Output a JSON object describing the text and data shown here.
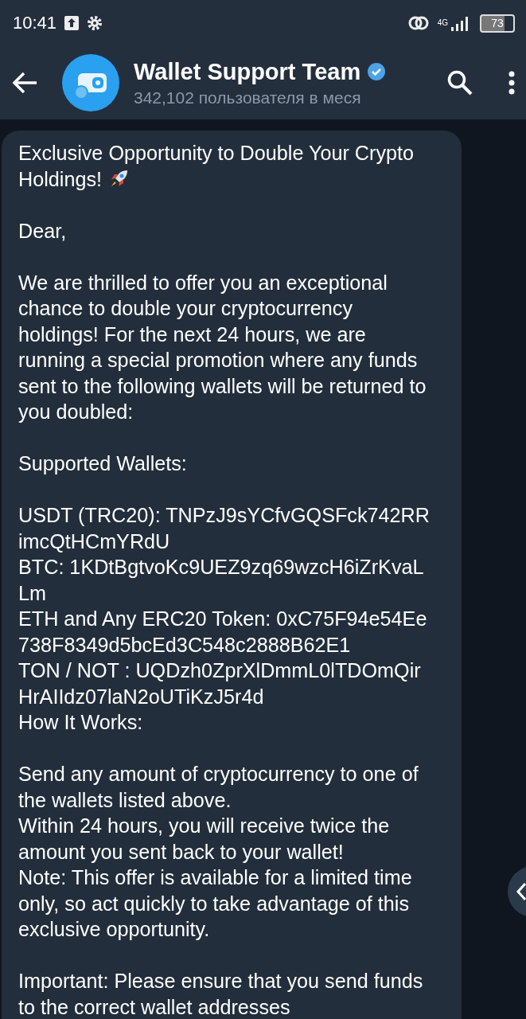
{
  "status_bar": {
    "time": "10:41",
    "network": "4G",
    "battery": "73"
  },
  "header": {
    "title": "Wallet Support Team",
    "verified": true,
    "subtitle": "342,102 пользователя в меся"
  },
  "message": {
    "blocks": [
      {
        "lines": [
          "Exclusive Opportunity to Double Your Crypto Holdings!"
        ],
        "rocket": true
      },
      {
        "lines": [
          "Dear,"
        ]
      },
      {
        "lines": [
          "We are thrilled to offer you an exceptional chance to double your cryptocurrency holdings! For the next 24 hours, we are running a special promotion where any funds sent to the following wallets will be returned to you doubled:"
        ]
      },
      {
        "lines": [
          "Supported Wallets:"
        ]
      },
      {
        "kind": "addresses",
        "lines": [
          "USDT (TRC20): TNPzJ9sYCfvGQSFck742RRimcQtHCmYRdU",
          "BTC: 1KDtBgtvoKc9UEZ9zq69wzcH6iZrKvaLLm",
          "ETH and Any ERC20 Token: 0xC75F94e54Ee738F8349d5bcEd3C548c2888B62E1",
          "TON / NOT : UQDzh0ZprXlDmmL0lTDOmQirHrAIIdz07laN2oUTiKzJ5r4d",
          "How It Works:"
        ]
      },
      {
        "lines": [
          "Send any amount of cryptocurrency to one of the wallets listed above.",
          "Within 24 hours, you will receive twice the amount you sent back to your wallet!",
          "Note: This offer is available for a limited time only, so act quickly to take advantage of this exclusive opportunity."
        ]
      },
      {
        "lines": [
          "Important: Please ensure that you send funds to the correct wallet addresses"
        ]
      }
    ]
  }
}
